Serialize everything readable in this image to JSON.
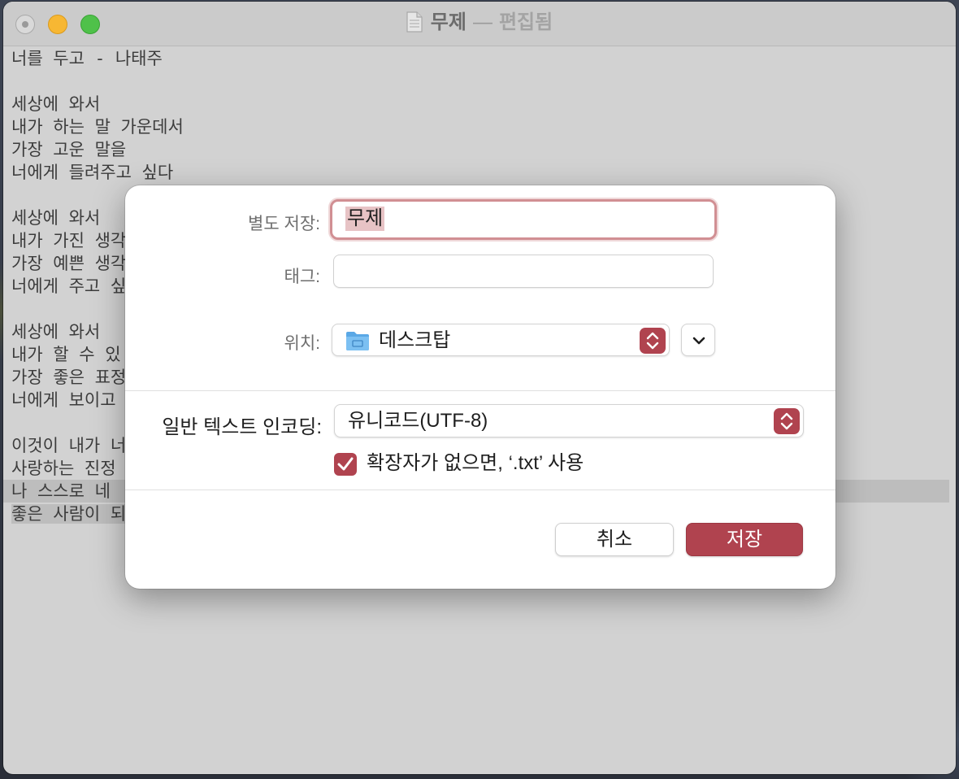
{
  "window": {
    "title": "무제",
    "separator": "—",
    "status": "편집됨"
  },
  "document": {
    "lines": [
      "너를 두고 - 나태주",
      "",
      "세상에 와서",
      "내가 하는 말 가운데서",
      "가장 고운 말을",
      "너에게 들려주고 싶다",
      "",
      "세상에 와서",
      "내가 가진 생각",
      "가장 예쁜 생각",
      "너에게 주고 싶",
      "",
      "세상에 와서",
      "내가 할 수 있",
      "가장 좋은 표정",
      "너에게 보이고",
      "",
      "이것이 내가 너",
      "사랑하는 진정",
      "나 스스로 네",
      "좋은 사람이 되"
    ]
  },
  "dialog": {
    "save_as_label": "별도 저장:",
    "filename_value": "무제",
    "tags_label": "태그:",
    "tags_value": "",
    "location_label": "위치:",
    "location_value": "데스크탑",
    "encoding_label": "일반 텍스트 인코딩:",
    "encoding_value": "유니코드(UTF-8)",
    "extension_checkbox_label": "확장자가 없으면, ‘.txt’ 사용",
    "extension_checked": true,
    "cancel_label": "취소",
    "save_label": "저장",
    "accent_color": "#b0434f"
  },
  "icons": {
    "document": "document-icon",
    "folder": "folder-icon",
    "stepper": "up-down-chevron-icon",
    "expand": "chevron-down-icon",
    "check": "checkmark-icon"
  }
}
